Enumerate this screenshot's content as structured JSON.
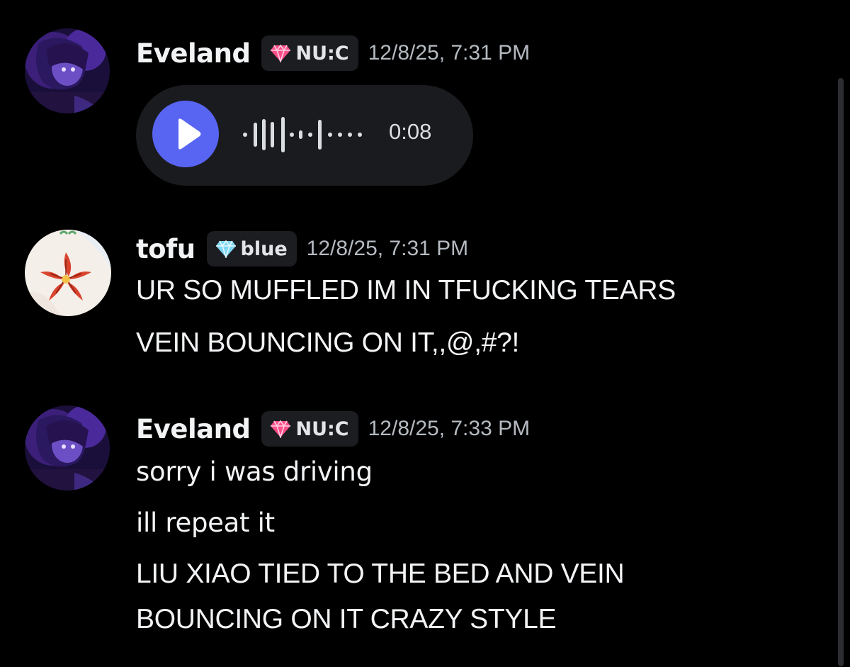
{
  "messages": [
    {
      "author": "Eveland",
      "tag": {
        "icon": "pink-gem-icon",
        "label": "NU:C",
        "icon_color": "#ff4f8b"
      },
      "timestamp": "12/8/25, 7:31 PM",
      "voice_message": {
        "duration": "0:08",
        "button_color": "#5865f2"
      }
    },
    {
      "author": "tofu",
      "tag": {
        "icon": "blue-diamond-icon",
        "label": "blue",
        "icon_color": "#7fd7f5"
      },
      "timestamp": "12/8/25, 7:31 PM",
      "lines": [
        "UR SO MUFFLED IM IN TFUCKING TEARS",
        "VEIN BOUNCING ON IT,,@,#?!"
      ]
    },
    {
      "author": "Eveland",
      "tag": {
        "icon": "pink-gem-icon",
        "label": "NU:C",
        "icon_color": "#ff4f8b"
      },
      "timestamp": "12/8/25, 7:33 PM",
      "lines": [
        "sorry i was driving",
        "ill repeat it",
        "LIU XIAO TIED TO THE BED AND VEIN",
        "BOUNCING ON IT CRAZY STYLE"
      ]
    }
  ],
  "colors": {
    "background": "#000000",
    "text": "#f2f3f5",
    "muted": "#b5bac1",
    "accent": "#5865f2"
  }
}
